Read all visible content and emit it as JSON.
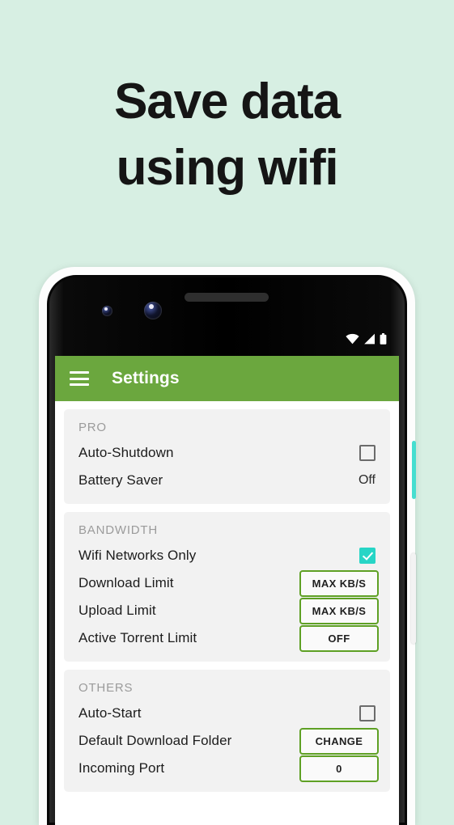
{
  "promo": {
    "headline_line1": "Save data",
    "headline_line2": "using wifi",
    "background_color": "#d7efe3",
    "text_color": "#151515"
  },
  "device": {
    "frame_color": "#fdfdfd",
    "bezel_color": "#070707",
    "power_button_color": "#46ded0",
    "volume_button_color": "#f3f3f3",
    "camera_count": 2,
    "speaker_grille": true
  },
  "statusbar": {
    "icons": [
      "wifi-icon",
      "cellular-signal-icon",
      "battery-icon"
    ]
  },
  "appbar": {
    "menu_icon": "hamburger-menu-icon",
    "title": "Settings",
    "background_color": "#6ba73e",
    "title_color": "#ffffff"
  },
  "colors": {
    "accent_green": "#5ea024",
    "checkbox_checked": "#27d5c6",
    "section_background": "#f2f2f2",
    "section_header_text": "#9b9b9b"
  },
  "sections": [
    {
      "header": "PRO",
      "rows": [
        {
          "label": "Auto-Shutdown",
          "control": "checkbox",
          "checked": false
        },
        {
          "label": "Battery Saver",
          "control": "text",
          "value": "Off"
        }
      ]
    },
    {
      "header": "BANDWIDTH",
      "rows": [
        {
          "label": "Wifi Networks Only",
          "control": "checkbox",
          "checked": true
        },
        {
          "label": "Download Limit",
          "control": "button",
          "value": "MAX KB/S"
        },
        {
          "label": "Upload Limit",
          "control": "button",
          "value": "MAX KB/S"
        },
        {
          "label": "Active Torrent Limit",
          "control": "button",
          "value": "OFF"
        }
      ]
    },
    {
      "header": "OTHERS",
      "rows": [
        {
          "label": "Auto-Start",
          "control": "checkbox",
          "checked": false
        },
        {
          "label": "Default Download Folder",
          "control": "button",
          "value": "CHANGE"
        },
        {
          "label": "Incoming Port",
          "control": "button",
          "value": "0"
        }
      ]
    }
  ]
}
